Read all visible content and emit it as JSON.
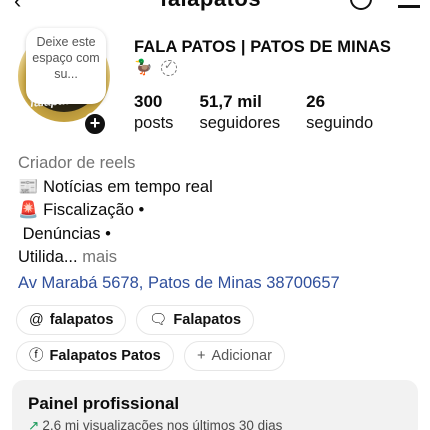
{
  "header": {
    "title": "falapatos"
  },
  "profile": {
    "note": "Deixe este espaço com su...",
    "avatar_logo": "falapatos",
    "name": "FALA PATOS | PATOS DE MINAS",
    "stats": [
      {
        "num": "300",
        "label": "posts"
      },
      {
        "num": "51,7 mil",
        "label": "seguidores"
      },
      {
        "num": "26",
        "label": "seguindo"
      }
    ]
  },
  "bio": {
    "category": "Criador de reels",
    "line1": "📰 Notícias em tempo real",
    "line2": "🚨 Fiscalização •",
    "line3": " Denúncias •",
    "line4": "Utilida...",
    "more": " mais",
    "address": "Av Marabá 5678, Patos de Minas 38700657"
  },
  "links": {
    "threads": "falapatos",
    "threads_icon": "@",
    "messenger": "Falapatos",
    "facebook": "Falapatos Patos",
    "add": "Adicionar"
  },
  "panel": {
    "title": "Painel profissional",
    "subtitle": "2,6 mi visualizações nos últimos 30 dias"
  }
}
